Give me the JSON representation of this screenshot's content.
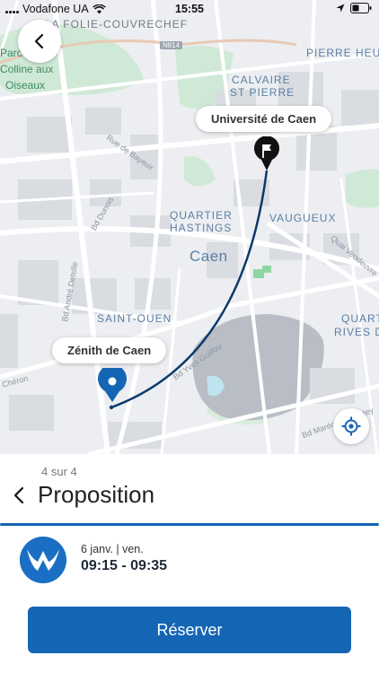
{
  "status_bar": {
    "carrier": "Vodafone UA",
    "time": "15:55"
  },
  "map": {
    "labels": {
      "folie": "LA FOLIE-COUVRECHEF",
      "calvaire": "CALVAIRE",
      "saint_pierre": "ST PIERRE",
      "pierre_heu": "PIERRE HEU",
      "quartier_hastings_1": "QUARTIER",
      "quartier_hastings_2": "HASTINGS",
      "vaugueux": "VAUGUEUX",
      "caen": "Caen",
      "saint_ouen": "SAINT-OUEN",
      "quart_1": "QUART",
      "quart_2": "RIVES D",
      "parc_1": "Parc",
      "parc_2": "Colline aux",
      "parc_3": "Oiseaux",
      "n814": "N814"
    },
    "streets": {
      "rue_de_bayeux": "Rue de Bayeux",
      "bd_dunois": "Bd Dunois",
      "bd_andre_detolle": "Bd André Detolle",
      "quai_vendeuvre": "Quai Vendeuvre",
      "bd_yves_guillou": "Bd Yves Guillou",
      "bd_marechal_lyautey": "Bd Maréchal Lyautey",
      "cheron": "Chéron"
    },
    "destination_label": "Université de Caen",
    "origin_label": "Zénith de Caen",
    "route_color": "#0d3a6b",
    "marker_color": "#1565b5"
  },
  "panel": {
    "step": "4 sur 4",
    "title": "Proposition",
    "date": "6 janv. | ven.",
    "time_range": "09:15 - 09:35",
    "reserve_label": "Réserver",
    "accent": "#1565b5"
  }
}
